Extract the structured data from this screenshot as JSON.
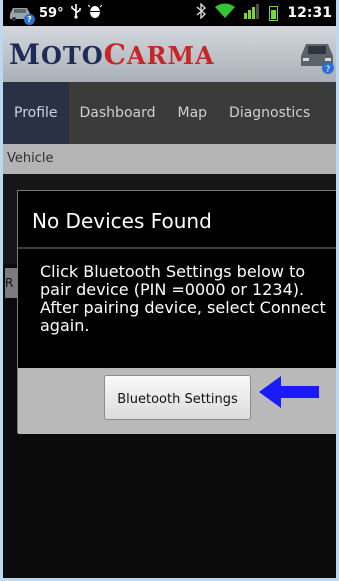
{
  "status_bar": {
    "temperature": "59°",
    "time": "12:31",
    "icons": [
      "car-notification-icon",
      "usb-icon",
      "android-debug-icon",
      "bluetooth-icon",
      "wifi-icon",
      "signal-icon",
      "battery-icon"
    ]
  },
  "app": {
    "logo_part1_big": "M",
    "logo_part1_rest": "OTO",
    "logo_part2_big": "C",
    "logo_part2_rest": "ARMA"
  },
  "tabs": [
    {
      "label": "Profile",
      "active": true
    },
    {
      "label": "Dashboard",
      "active": false
    },
    {
      "label": "Map",
      "active": false
    },
    {
      "label": "Diagnostics",
      "active": false
    }
  ],
  "section": {
    "label": "Vehicle"
  },
  "background_fragment": {
    "label": "R"
  },
  "dialog": {
    "title": "No Devices Found",
    "message": "Click Bluetooth Settings below to pair device (PIN =0000 or 1234). After pairing device, select Connect again.",
    "button_label": "Bluetooth Settings"
  },
  "colors": {
    "accent_blue": "#1a1aff",
    "logo_navy": "#1d2c57",
    "logo_red": "#c72626",
    "frame_border": "#bcd8f0"
  }
}
